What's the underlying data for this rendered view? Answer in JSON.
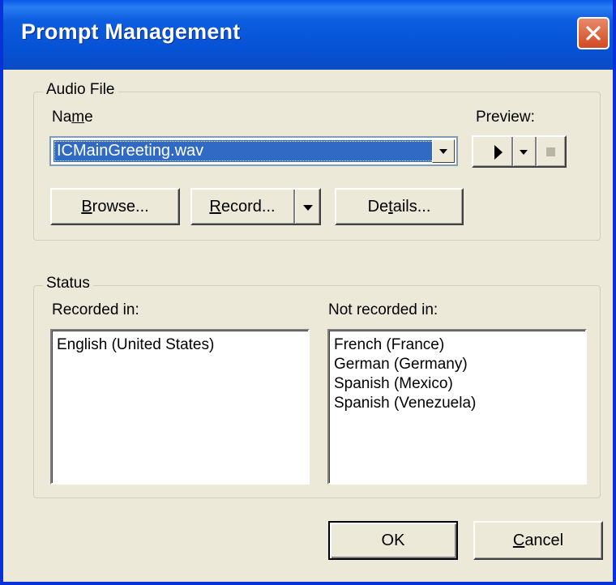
{
  "window": {
    "title": "Prompt Management"
  },
  "audio_file": {
    "group_label": "Audio File",
    "name_label": "Name",
    "name_value": "ICMainGreeting.wav",
    "preview_label": "Preview:",
    "browse_label": "Browse...",
    "record_label": "Record...",
    "details_label": "Details..."
  },
  "status": {
    "group_label": "Status",
    "recorded_label": "Recorded in:",
    "recorded_items": [
      "English (United States)"
    ],
    "not_recorded_label": "Not recorded in:",
    "not_recorded_items": [
      "French (France)",
      "German (Germany)",
      "Spanish (Mexico)",
      "Spanish (Venezuela)"
    ]
  },
  "buttons": {
    "ok_label": "OK",
    "cancel_label": "Cancel"
  },
  "colors": {
    "titlebar": "#0652d5",
    "selection": "#316ac5",
    "face": "#ece9d8",
    "close": "#d24a23"
  },
  "icons": [
    "close-icon",
    "chevron-down-icon",
    "play-icon",
    "stop-icon"
  ]
}
